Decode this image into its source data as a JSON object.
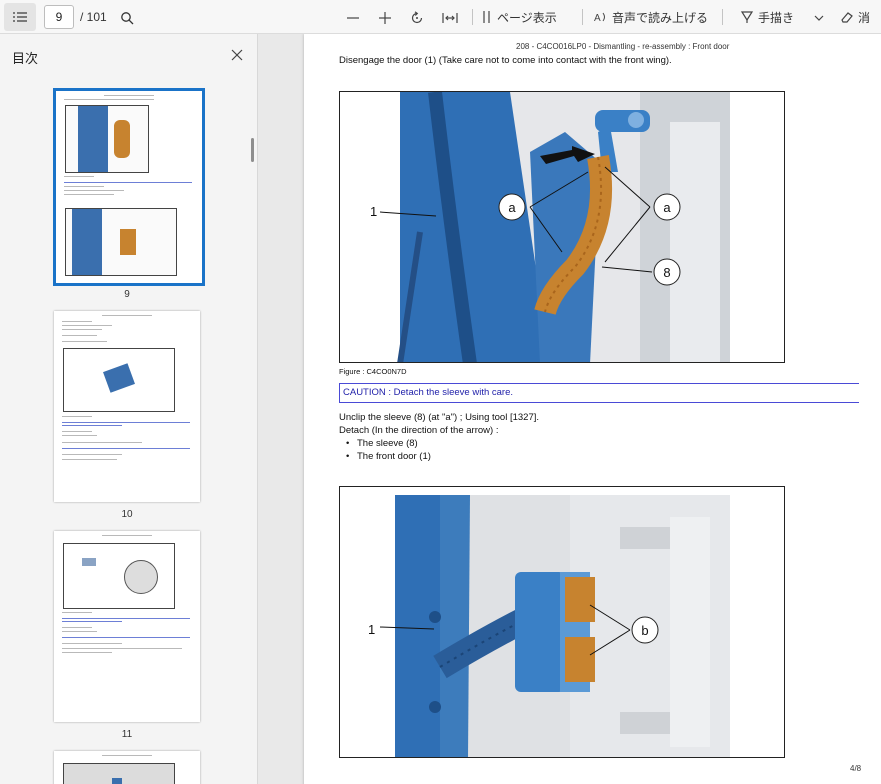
{
  "toolbar": {
    "current_page": "9",
    "total_pages": "/ 101",
    "page_view_label": "ページ表示",
    "read_aloud_label": "音声で読み上げる",
    "draw_label": "手描き",
    "erase_label": "消"
  },
  "sidebar": {
    "title": "目次",
    "thumbnails": [
      {
        "label": "9"
      },
      {
        "label": "10"
      },
      {
        "label": "11"
      }
    ]
  },
  "document": {
    "header": "208 - C4CO016LP0 - Dismantling - re-assembly : Front door",
    "instruction_1": "Disengage the door (1) (Take care not to come into contact with the front wing).",
    "figure_1": {
      "callout_1": "1",
      "callout_a1": "a",
      "callout_a2": "a",
      "callout_8": "8"
    },
    "figure_caption": "Figure : C4CO0N7D",
    "caution": "CAUTION : Detach the sleeve with care.",
    "instruction_2": "Unclip the sleeve (8) (at \"a\") ; Using tool [1327].",
    "instruction_3": "Detach (In the direction of the arrow) :",
    "bullets": [
      "The sleeve (8)",
      "The front door (1)"
    ],
    "figure_2": {
      "callout_1": "1",
      "callout_b": "b"
    },
    "page_number": "4/8"
  },
  "colors": {
    "accent": "#1a73c8",
    "caution_border": "#4a4ad6",
    "part_blue": "#2f6fb5",
    "sleeve_orange": "#c7832f"
  }
}
